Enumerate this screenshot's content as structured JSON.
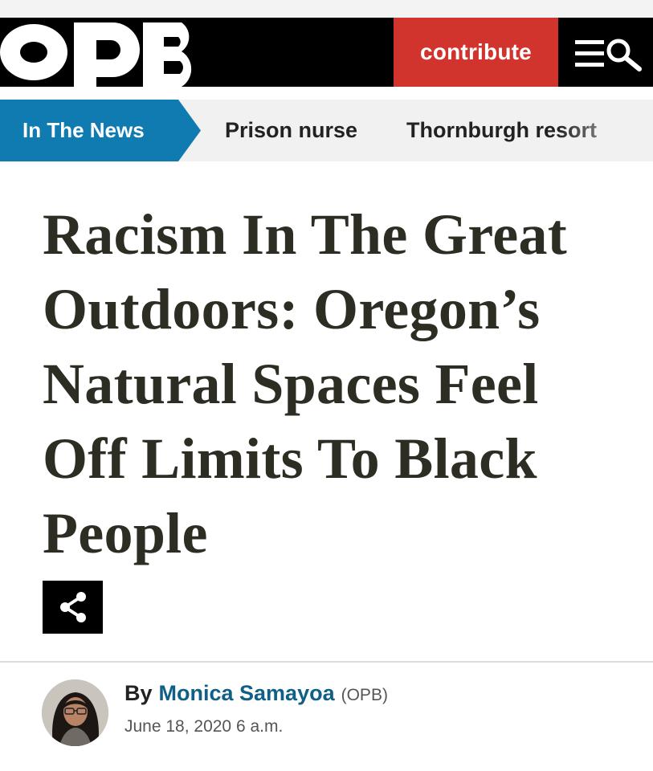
{
  "header": {
    "logo_text": "OPB",
    "contribute_label": "contribute",
    "colors": {
      "background": "#000000",
      "contribute": "#d0342c"
    }
  },
  "nav": {
    "items": [
      {
        "label": "In The News",
        "active": true
      },
      {
        "label": "Prison nurse"
      },
      {
        "label": "Thornburgh resort"
      }
    ],
    "colors": {
      "active": "#0f7bb0",
      "bar": "#f1f1f1"
    }
  },
  "article": {
    "headline": "Racism In The Great Outdoors: Oregon’s Natural Spaces Feel Off Limits To Black People",
    "byline_prefix": "By",
    "author": "Monica Samayoa",
    "organization": "(OPB)",
    "date": "June 18, 2020 6 a.m."
  },
  "icons": {
    "share": "share-icon",
    "menu": "menu-icon",
    "search": "search-icon"
  }
}
